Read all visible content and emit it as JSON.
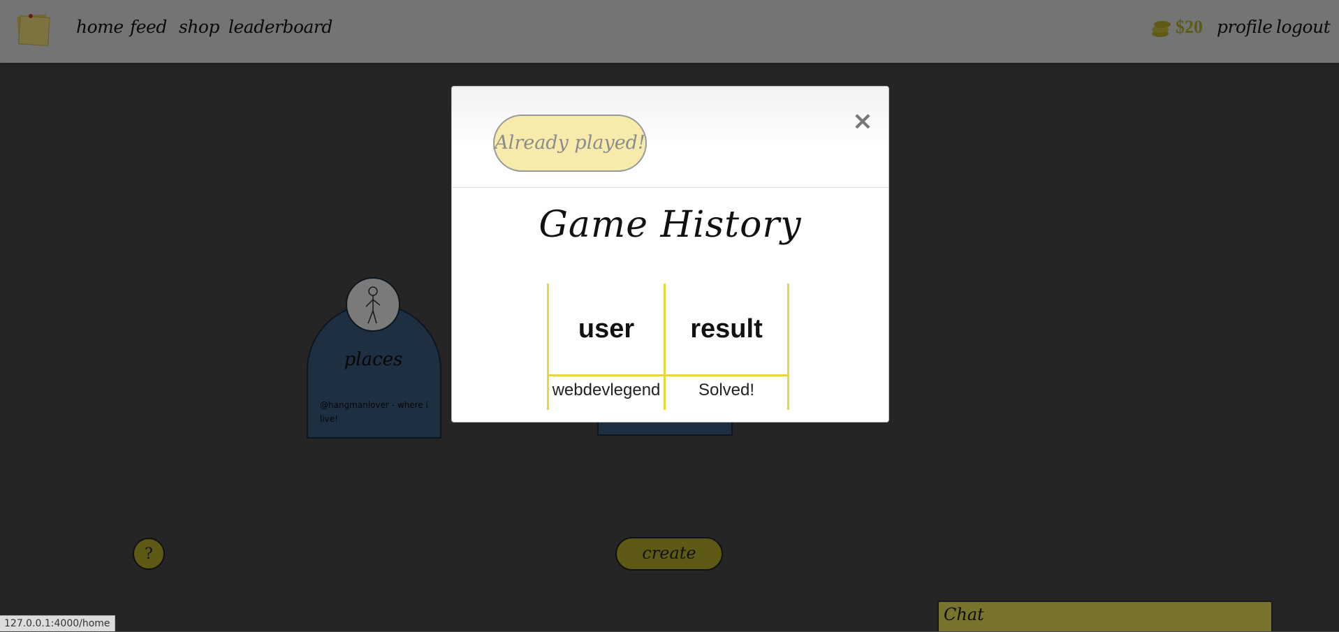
{
  "nav": {
    "links": [
      "home",
      "feed",
      "shop",
      "leaderboard"
    ],
    "money": "$20",
    "profile": "profile",
    "logout": "logout"
  },
  "background": {
    "card_title": "places",
    "card_caption": "@hangmanlover - where i live!",
    "help": "?",
    "create": "create",
    "chat": "Chat"
  },
  "modal": {
    "played_label": "Already played!",
    "close": "×",
    "title": "Game History",
    "columns": [
      "user",
      "result"
    ],
    "rows": [
      {
        "user": "webdevlegend",
        "result": "Solved!"
      }
    ]
  },
  "status_url": "127.0.0.1:4000/home",
  "colors": {
    "accent": "#bdb52a",
    "table_border": "#e8d73a",
    "button_fill": "#f7ebac"
  }
}
